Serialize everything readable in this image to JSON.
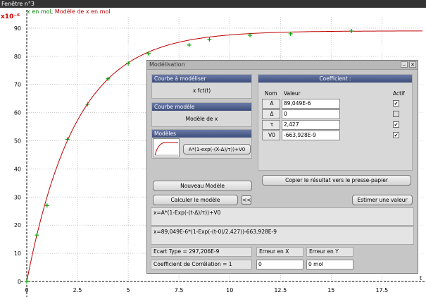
{
  "window_title": "Fenêtre n°3",
  "legend": {
    "series1": "x en mol",
    "sep": ", ",
    "series2": "Modèle de x en mol"
  },
  "y_unit": "x10⁻⁶",
  "chart_data": {
    "type": "scatter",
    "x_ticks": [
      "0",
      "2.5",
      "5",
      "7.5",
      "10",
      "12.5",
      "15",
      "17.5"
    ],
    "y_ticks": [
      "0",
      "10",
      "20",
      "30",
      "40",
      "50",
      "60",
      "70",
      "80",
      "90"
    ],
    "xlim": [
      0,
      19.5
    ],
    "ylim": [
      0,
      94
    ],
    "x_axis_label": "t",
    "series": [
      {
        "color": "#00a000",
        "x": [
          0,
          0.5,
          1,
          2,
          3,
          4,
          5,
          6,
          8,
          9,
          11,
          13,
          16
        ],
        "y": [
          0,
          16.5,
          27,
          50.5,
          63,
          72,
          77.5,
          81,
          84,
          86,
          87.5,
          88,
          89
        ]
      }
    ],
    "model": {
      "color": "#c00000",
      "A": 89.049,
      "tau": 2.427,
      "delta": 0,
      "V0": -0.000663928
    }
  },
  "dialog": {
    "title": "Modélisation",
    "courbe_a_modeliser": {
      "header": "Courbe à modéliser",
      "value": "x  fct(t)"
    },
    "courbe_modele": {
      "header": "Courbe modèle",
      "value": "Modèle de x"
    },
    "modeles": {
      "header": "Modèles",
      "formula_button": "A*(1-exp(-(X-Δ)/τ))+V0"
    },
    "coefficient": {
      "header": "Coefficient :",
      "col_nom": "Nom",
      "col_valeur": "Valeur",
      "col_actif": "Actif",
      "rows": [
        {
          "name": "A",
          "value": "89,049E-6",
          "active": "✔"
        },
        {
          "name": "Δ",
          "value": "0",
          "active": ""
        },
        {
          "name": "τ",
          "value": "2,427",
          "active": "✔"
        },
        {
          "name": "V0",
          "value": "-663,928E-9",
          "active": "✔"
        }
      ]
    },
    "buttons": {
      "copy": "Copier le résultat vers le presse-papier",
      "nouveau": "Nouveau Modèle",
      "calculer": "Calculer le modèle",
      "collapse": "<<",
      "estimer": "Estimer une valeur"
    },
    "formula_generic": "x=A*(1-Exp(-(t-Δ)/τ))+V0",
    "formula_fitted": "x=89,049E-6*(1-Exp(-(t-0)/2,427))-663,928E-9",
    "ecart_type": "Ecart Type = 297,206E-9",
    "correlation": "Coefficient de Corrélation = 1",
    "erreur_x": {
      "label": "Erreur en X",
      "value": "0"
    },
    "erreur_y": {
      "label": "Erreur en Y",
      "value": "0 mol"
    }
  }
}
